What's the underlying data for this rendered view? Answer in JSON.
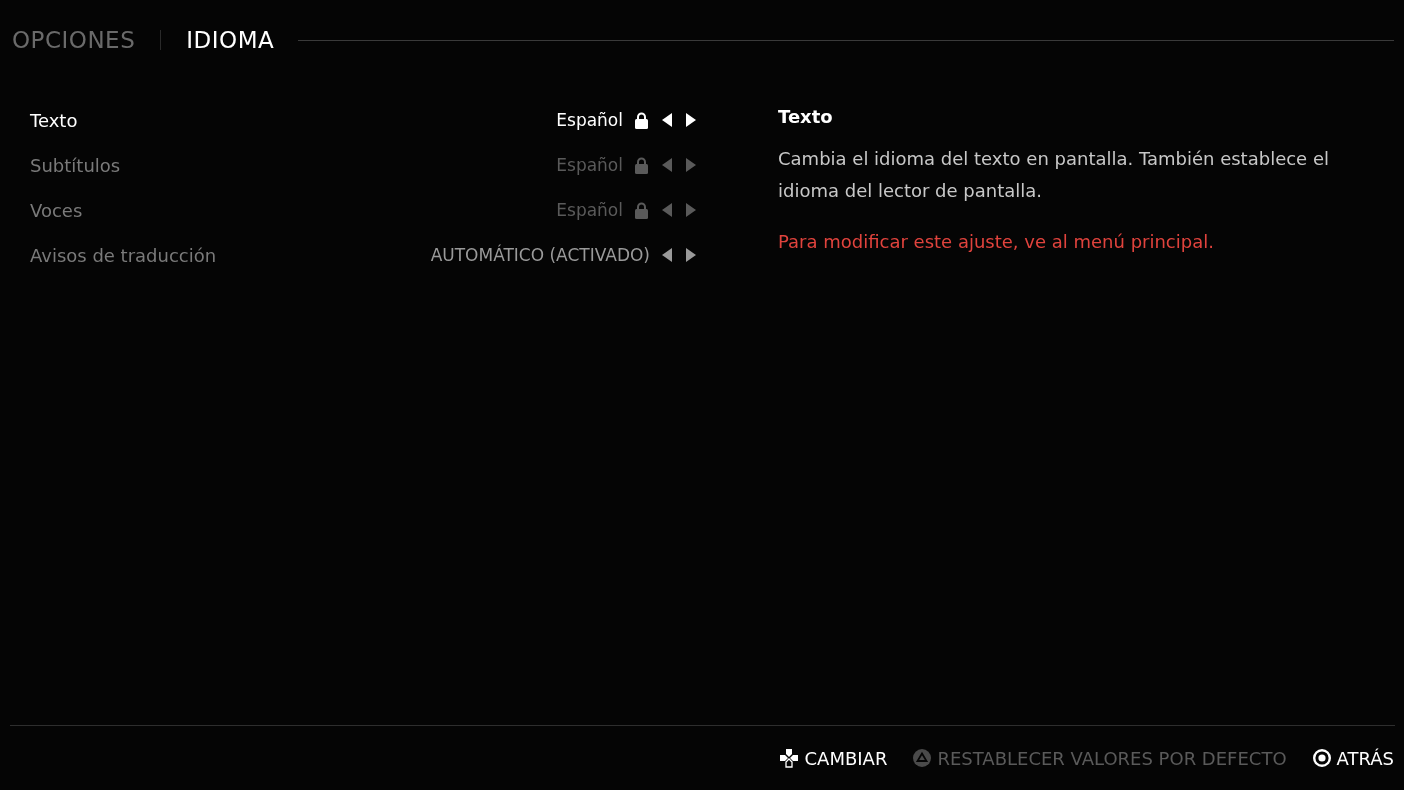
{
  "tabs": [
    {
      "label": "OPCIONES",
      "selected": false
    },
    {
      "label": "IDIOMA",
      "selected": true
    }
  ],
  "settings": [
    {
      "label": "Texto",
      "value": "Español",
      "locked": true,
      "disabled": false,
      "selected": true
    },
    {
      "label": "Subtítulos",
      "value": "Español",
      "locked": true,
      "disabled": true,
      "selected": false
    },
    {
      "label": "Voces",
      "value": "Español",
      "locked": true,
      "disabled": true,
      "selected": false
    },
    {
      "label": "Avisos de traducción",
      "value": "AUTOMÁTICO (ACTIVADO)",
      "locked": false,
      "disabled": false,
      "selected": false
    }
  ],
  "details": {
    "title": "Texto",
    "description": "Cambia el idioma del texto en pantalla. También establece el idioma del lector de pantalla.",
    "warning": "Para modificar este ajuste, ve al menú principal."
  },
  "footer": [
    {
      "kind": "dpad",
      "label": "CAMBIAR",
      "disabled": false
    },
    {
      "kind": "triangle",
      "label": "RESTABLECER VALORES POR DEFECTO",
      "disabled": true
    },
    {
      "kind": "circle",
      "label": "ATRÁS",
      "disabled": false
    }
  ]
}
